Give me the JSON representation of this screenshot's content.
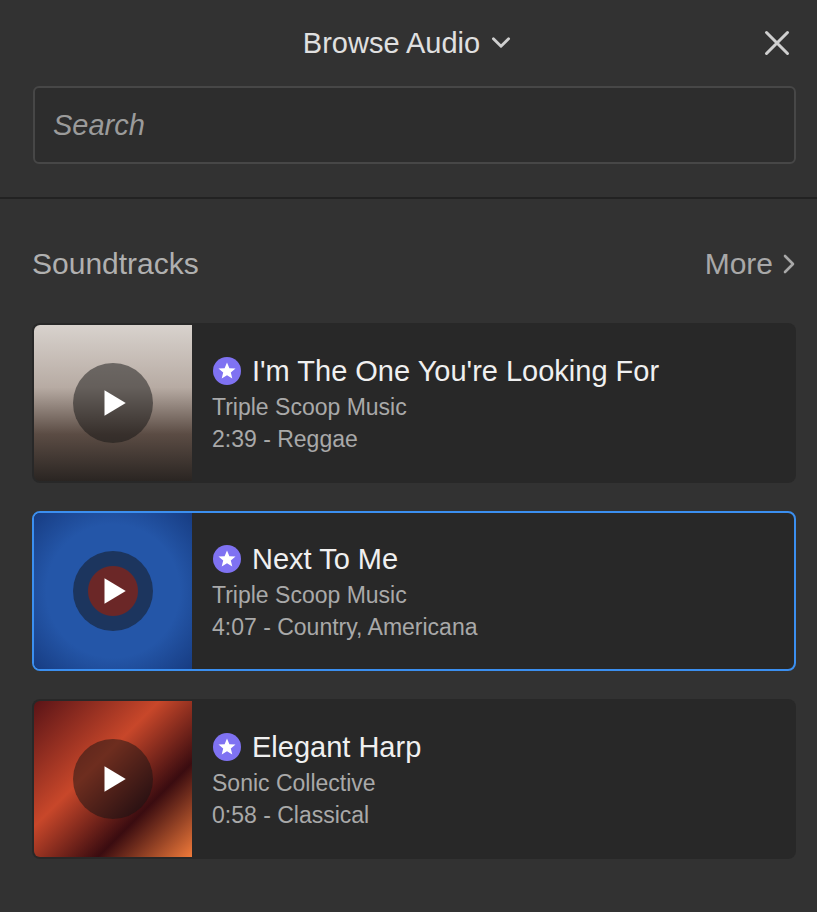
{
  "window": {
    "title": "Browse Audio"
  },
  "search": {
    "placeholder": "Search"
  },
  "section": {
    "title": "Soundtracks",
    "more": "More"
  },
  "tracks": [
    {
      "title": "I'm The One You're Looking For",
      "artist": "Triple Scoop Music",
      "meta": "2:39 - Reggae",
      "premium": true,
      "selected": false
    },
    {
      "title": "Next To Me",
      "artist": "Triple Scoop Music",
      "meta": "4:07 - Country, Americana",
      "premium": true,
      "selected": true
    },
    {
      "title": "Elegant Harp",
      "artist": "Sonic Collective",
      "meta": "0:58 - Classical",
      "premium": true,
      "selected": false
    }
  ]
}
